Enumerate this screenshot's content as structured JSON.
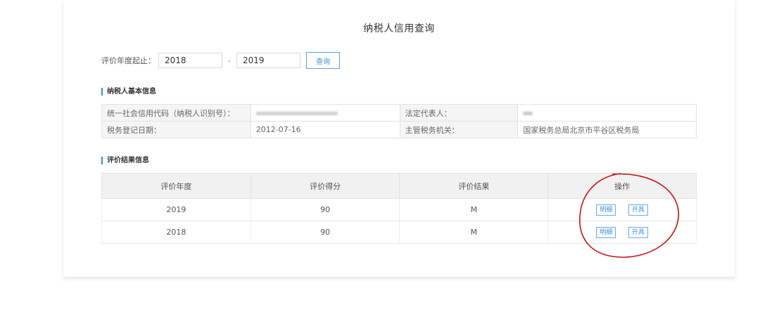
{
  "page": {
    "title": "纳税人信用查询"
  },
  "filter": {
    "label": "评价年度起止：",
    "start_year": "2018",
    "separator": "-",
    "end_year": "2019",
    "query_label": "查询"
  },
  "basic_info": {
    "section_title": "纳税人基本信息",
    "rows": [
      {
        "label1": "统一社会信用代码（纳税人识别号）：",
        "value1": "",
        "label2": "法定代表人：",
        "value2": ""
      },
      {
        "label1": "税务登记日期：",
        "value1": "2012-07-16",
        "label2": "主管税务机关：",
        "value2": "国家税务总局北京市平谷区税务局"
      }
    ]
  },
  "results": {
    "section_title": "评价结果信息",
    "headers": [
      "评价年度",
      "评价得分",
      "评价结果",
      "操作"
    ],
    "rows": [
      {
        "year": "2019",
        "score": "90",
        "grade": "M",
        "detail_label": "明细",
        "issue_label": "开具"
      },
      {
        "year": "2018",
        "score": "90",
        "grade": "M",
        "detail_label": "明细",
        "issue_label": "开具"
      }
    ]
  },
  "colors": {
    "accent": "#2d8cf0",
    "annotation": "#cc1111"
  }
}
